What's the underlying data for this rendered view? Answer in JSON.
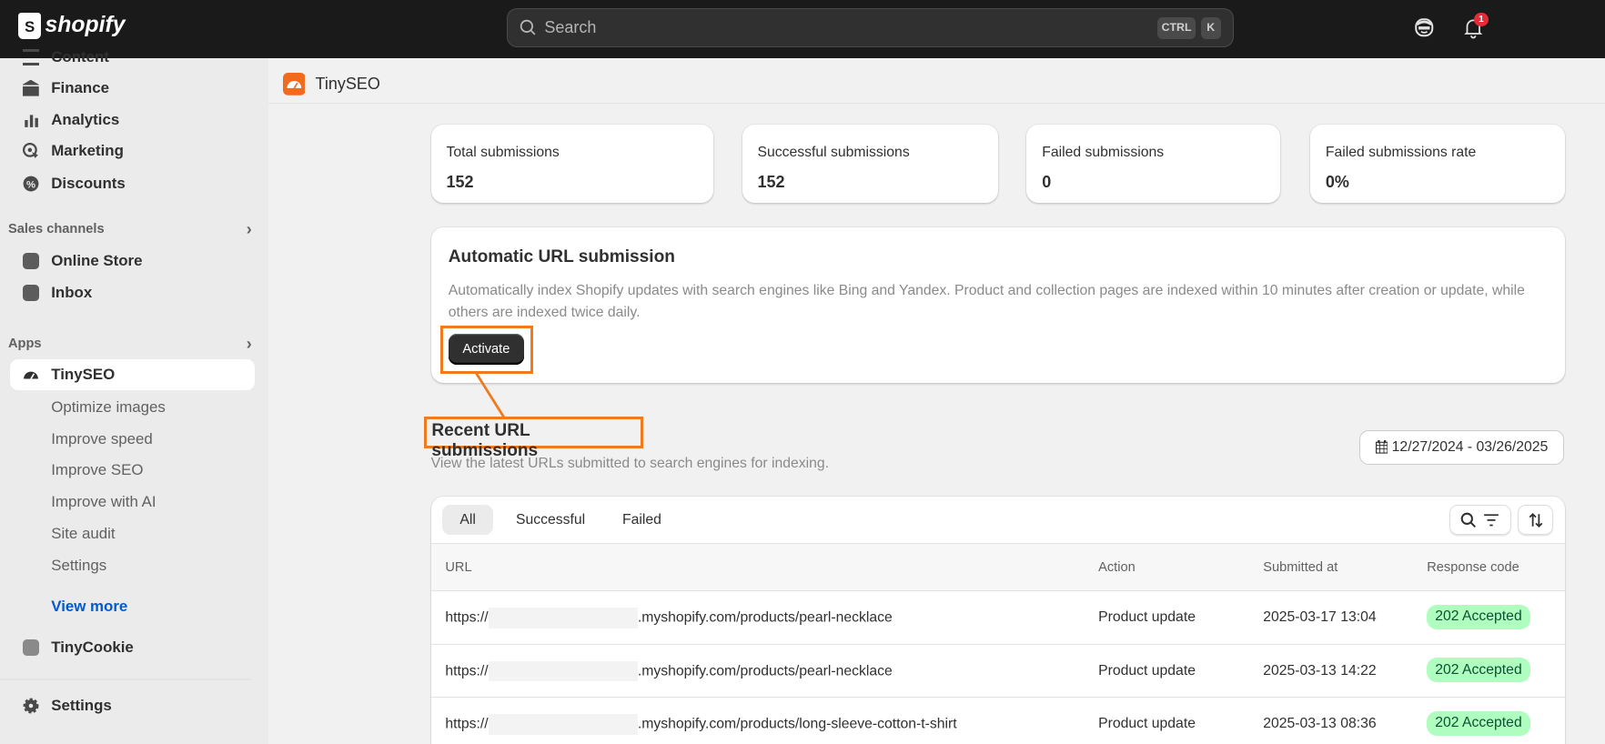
{
  "topbar": {
    "brand": "shopify",
    "search_placeholder": "Search",
    "kbd1": "CTRL",
    "kbd2": "K",
    "notification_count": "1"
  },
  "sidebar": {
    "items": [
      {
        "label": "Content"
      },
      {
        "label": "Finance"
      },
      {
        "label": "Analytics"
      },
      {
        "label": "Marketing"
      },
      {
        "label": "Discounts"
      }
    ],
    "sales_channels": {
      "label": "Sales channels",
      "items": [
        {
          "label": "Online Store"
        },
        {
          "label": "Inbox"
        }
      ]
    },
    "apps": {
      "label": "Apps",
      "active": "TinySEO",
      "subitems": [
        "Optimize images",
        "Improve speed",
        "Improve SEO",
        "Improve with AI",
        "Site audit",
        "Settings"
      ],
      "view_more": "View more",
      "other": "TinyCookie"
    },
    "settings": "Settings"
  },
  "header": {
    "app_title": "TinySEO"
  },
  "stats": [
    {
      "label": "Total submissions",
      "value": "152"
    },
    {
      "label": "Successful submissions",
      "value": "152"
    },
    {
      "label": "Failed submissions",
      "value": "0"
    },
    {
      "label": "Failed submissions rate",
      "value": "0%"
    }
  ],
  "auto": {
    "title": "Automatic URL submission",
    "desc": "Automatically index Shopify updates with search engines like Bing and Yandex. Product and collection pages are indexed within 10 minutes after creation or update, while others are indexed twice daily.",
    "button": "Activate"
  },
  "recent": {
    "title": "Recent URL submissions",
    "subtitle": "View the latest URLs submitted to search engines for indexing.",
    "date_range": "12/27/2024 - 03/26/2025"
  },
  "table": {
    "tabs": [
      "All",
      "Successful",
      "Failed"
    ],
    "columns": [
      "URL",
      "Action",
      "Submitted at",
      "Response code"
    ],
    "rows": [
      {
        "url_prefix": "https://",
        "url_suffix": ".myshopify.com/products/pearl-necklace",
        "action": "Product update",
        "submitted": "2025-03-17 13:04",
        "code": "202 Accepted"
      },
      {
        "url_prefix": "https://",
        "url_suffix": ".myshopify.com/products/pearl-necklace",
        "action": "Product update",
        "submitted": "2025-03-13 14:22",
        "code": "202 Accepted"
      },
      {
        "url_prefix": "https://",
        "url_suffix": ".myshopify.com/products/long-sleeve-cotton-t-shirt",
        "action": "Product update",
        "submitted": "2025-03-13 08:36",
        "code": "202 Accepted"
      }
    ]
  },
  "colors": {
    "highlight": "#f07b1f",
    "accent_blue": "#005bd3",
    "badge_bg": "#affebf"
  }
}
